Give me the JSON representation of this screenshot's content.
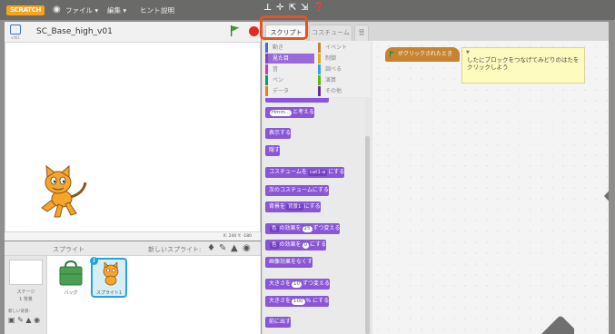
{
  "menubar": {
    "logo": "SCRATCH",
    "items": [
      "ファイル ▾",
      "編集 ▾",
      "ヒント",
      "説明"
    ]
  },
  "project": {
    "name": "SC_Base_high_v01",
    "version": "v461"
  },
  "stage": {
    "coords": "X: 240  Y: -180"
  },
  "sprites": {
    "title": "スプライト",
    "new_sprite_label": "新しいスプライト:",
    "stage_label": "ステージ",
    "stage_count": "1 背景",
    "new_backdrop_label": "新しい背景:",
    "items": [
      {
        "name": "バッグ"
      },
      {
        "name": "スプライト1"
      }
    ]
  },
  "tabs": [
    "スクリプト",
    "コスチューム",
    "音"
  ],
  "categories": {
    "left": [
      "動き",
      "見た目",
      "音",
      "ペン",
      "データ"
    ],
    "right": [
      "イベント",
      "制御",
      "調べる",
      "演算",
      "その他"
    ],
    "selected": "見た目",
    "colors": {
      "motion": "#4a6cd4",
      "looks": "#8a55d7",
      "sound": "#bb42c3",
      "pen": "#0e9a6c",
      "data": "#ee7d16",
      "events": "#c88330",
      "control": "#e1a91a",
      "sensing": "#2ca5e2",
      "operators": "#5cb712",
      "more": "#632d99"
    }
  },
  "blocks": {
    "think": {
      "slot": "Hmm...",
      "text": "と考える"
    },
    "show": "表示する",
    "hide": "隠す",
    "switch_costume": {
      "prefix": "コスチュームを",
      "drop": "cat1-a",
      "suffix": "にする"
    },
    "next_costume": "次のコスチュームにする",
    "switch_backdrop": {
      "prefix": "背景を",
      "drop": "背景1",
      "suffix": "にする"
    },
    "change_effect": {
      "drop": "色",
      "mid": "の効果を",
      "value": "25",
      "suffix": "ずつ変える"
    },
    "set_effect": {
      "drop": "色",
      "mid": "の効果を",
      "value": "0",
      "suffix": "にする"
    },
    "clear_effects": "画像効果をなくす",
    "change_size": {
      "prefix": "大きさを",
      "value": "10",
      "suffix": "ずつ変える"
    },
    "set_size": {
      "prefix": "大きさを",
      "value": "100",
      "suffix": "% にする"
    },
    "front": "前に出す"
  },
  "script": {
    "hat_label": "がクリックされたとき",
    "comment": "したにブロックをつなげてみどりのはたをクリックしよう"
  }
}
